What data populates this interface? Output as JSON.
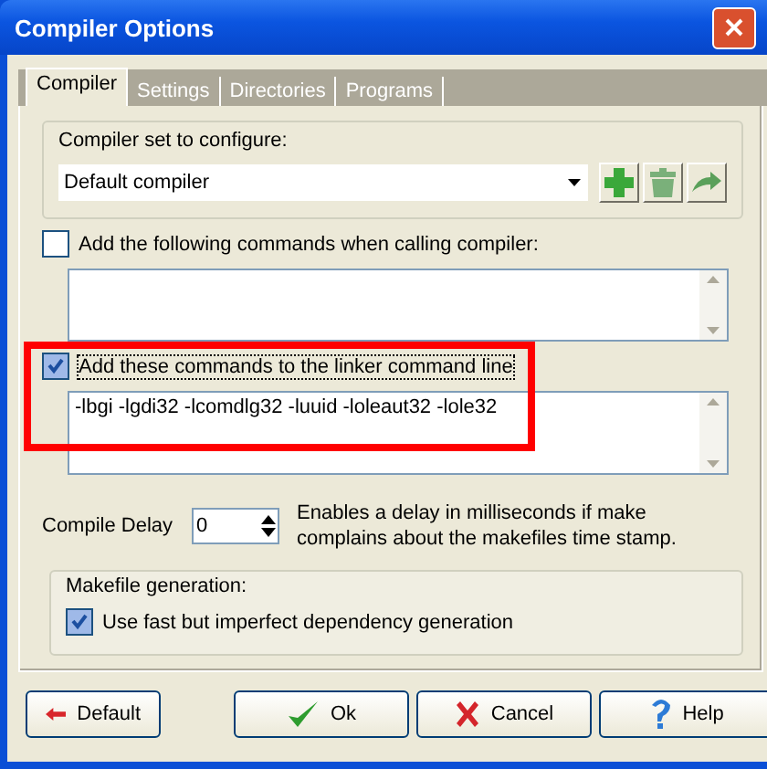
{
  "window": {
    "title": "Compiler Options"
  },
  "tabs": [
    {
      "label": "Compiler",
      "selected": true
    },
    {
      "label": "Settings",
      "selected": false
    },
    {
      "label": "Directories",
      "selected": false
    },
    {
      "label": "Programs",
      "selected": false
    }
  ],
  "compiler_set": {
    "label": "Compiler set to configure:",
    "value": "Default compiler"
  },
  "compiler_commands": {
    "label": "Add the following commands when calling compiler:",
    "checked": false
  },
  "linker_commands": {
    "label": "Add these commands to the linker command line",
    "checked": true,
    "highlighted": true,
    "value": "-lbgi -lgdi32 -lcomdlg32 -luuid -loleaut32 -lole32"
  },
  "compile_delay": {
    "label": "Compile Delay",
    "value": "0",
    "hint": "Enables a delay in milliseconds if make complains about the makefiles time stamp."
  },
  "makefile_generation": {
    "label": "Makefile generation:",
    "option": {
      "label": "Use fast but imperfect dependency generation",
      "checked": true
    }
  },
  "buttons": [
    {
      "label": "Default",
      "kind": "default"
    },
    {
      "label": "Ok",
      "kind": "ok"
    },
    {
      "label": "Cancel",
      "kind": "cancel"
    },
    {
      "label": "Help",
      "kind": "help"
    }
  ]
}
